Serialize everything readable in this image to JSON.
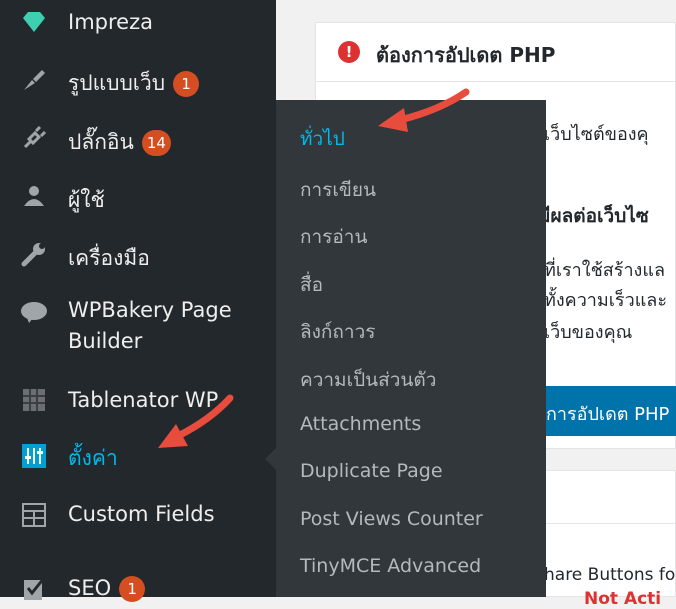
{
  "sidebar": {
    "items": [
      {
        "label": "Impreza",
        "icon": "diamond-icon",
        "badge": ""
      },
      {
        "label": "รูปแบบเว็บ",
        "icon": "brush-icon",
        "badge": "1"
      },
      {
        "label": "ปลั๊กอิน",
        "icon": "plugin-icon",
        "badge": "14"
      },
      {
        "label": "ผู้ใช้",
        "icon": "user-icon",
        "badge": ""
      },
      {
        "label": "เครื่องมือ",
        "icon": "wrench-icon",
        "badge": ""
      },
      {
        "label_line1": "WPBakery Page",
        "label_line2": "Builder",
        "icon": "wpbakery-cloud-icon"
      },
      {
        "label": "Tablenator WP",
        "icon": "table-grid-icon",
        "badge": ""
      },
      {
        "label": "ตั้งค่า",
        "icon": "settings-sliders-icon",
        "badge": ""
      },
      {
        "label": "Custom Fields",
        "icon": "custom-fields-icon",
        "badge": ""
      },
      {
        "label": "SEO",
        "icon": "seo-check-icon",
        "badge": "1"
      }
    ]
  },
  "submenu": {
    "items": [
      {
        "label": "ทั่วไป",
        "current": true
      },
      {
        "label": "การเขียน"
      },
      {
        "label": "การอ่าน"
      },
      {
        "label": "สื่อ"
      },
      {
        "label": "ลิงก์ถาวร"
      },
      {
        "label": "ความเป็นส่วนตัว"
      },
      {
        "label": "Attachments"
      },
      {
        "label": "Duplicate Page"
      },
      {
        "label": "Post Views Counter"
      },
      {
        "label": "TinyMCE Advanced"
      }
    ]
  },
  "notice": {
    "icon": "exclamation-circle-icon",
    "title": "ต้องการอัปเดต PHP",
    "text1": "เว็บไซต์ของคุ",
    "heading": "มีผลต่อเว็บไซ",
    "text2": "ที่เราใช้สร้างแล",
    "text3": "ทั้งความเร็วและ",
    "text4": "เว็บของคุณ",
    "button": "การอัปเดต PHP"
  },
  "lower": {
    "text1": "hare Buttons fo",
    "text2": "Not Acti"
  },
  "colors": {
    "sidebar_bg": "#23282d",
    "submenu_bg": "#32373c",
    "active_bg": "#0073aa",
    "current_link": "#00b9eb",
    "badge": "#d54e21",
    "arrow": "#e74c3c"
  }
}
